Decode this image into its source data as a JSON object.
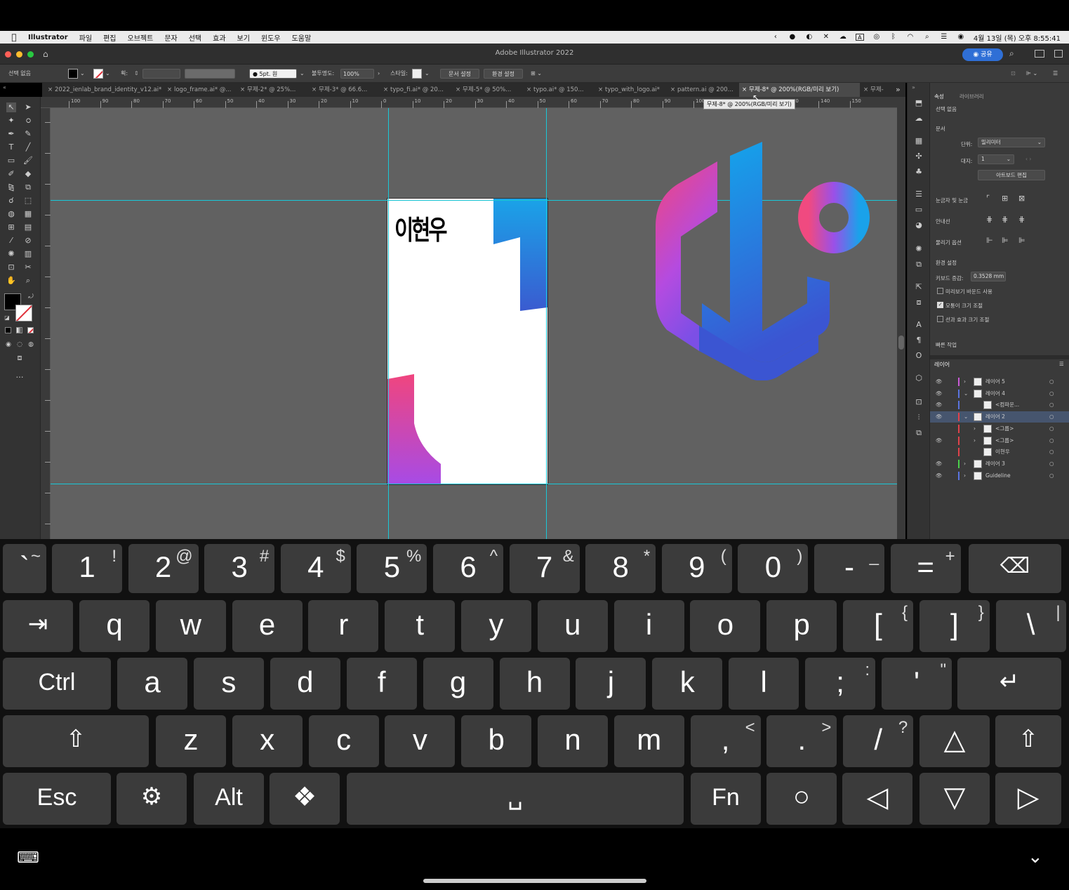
{
  "menubar": {
    "app": "Illustrator",
    "items": [
      "파일",
      "편집",
      "오브젝트",
      "문자",
      "선택",
      "효과",
      "보기",
      "윈도우",
      "도움말"
    ],
    "datetime": "4월 13일 (목) 오후 8:55:41",
    "input_indicator": "A"
  },
  "titlebar": {
    "title": "Adobe Illustrator 2022",
    "share": "공유"
  },
  "controlbar": {
    "selection": "선택 없음",
    "stroke_label": "획:",
    "brush": "5pt. 원",
    "opacity_label": "불투명도:",
    "opacity_value": "100%",
    "style_label": "스타일:",
    "doc_setup": "문서 설정",
    "prefs": "환경 설정"
  },
  "tabs": [
    {
      "label": "2022_ienlab_brand_identity_v12.ai*"
    },
    {
      "label": "logo_frame.ai* @..."
    },
    {
      "label": "무제-2* @ 25%..."
    },
    {
      "label": "무제-3* @ 66.6..."
    },
    {
      "label": "typo_fi.ai* @ 20..."
    },
    {
      "label": "무제-5* @ 50%..."
    },
    {
      "label": "typo.ai* @ 150..."
    },
    {
      "label": "typo_with_logo.ai*"
    },
    {
      "label": "pattern.ai @ 200..."
    },
    {
      "label": "무제-8* @ 200%(RGB/미리 보기)"
    },
    {
      "label": "무제-"
    }
  ],
  "tooltip": "무제-8* @ 200%(RGB/미리 보기)",
  "ruler": {
    "h_ticks": [
      "100",
      "90",
      "80",
      "70",
      "60",
      "50",
      "40",
      "30",
      "20",
      "10",
      "0",
      "10",
      "20",
      "30",
      "40",
      "50",
      "60",
      "70",
      "80",
      "90",
      "100",
      "110",
      "120",
      "130",
      "140",
      "150"
    ]
  },
  "artwork": {
    "name_text": "이현우"
  },
  "panel": {
    "tabs": [
      "속성",
      "라이브러리"
    ],
    "selection": "선택 없음",
    "doc_header": "문서",
    "unit_label": "단위:",
    "unit_value": "밀리미터",
    "artboard_label": "대지:",
    "artboard_value": "1",
    "artboard_edit": "아트보드 편집",
    "ruler_grid": "눈금자 및 눈금",
    "guides": "안내선",
    "snap": "물리기 옵션",
    "prefs_header": "환경 설정",
    "keyboard_inc_label": "키보드 증감:",
    "keyboard_inc_value": "0.3528 mm",
    "cb_preview_bounds": "미리보기 바운드 사용",
    "cb_scale_corners": "모퉁이 크기 조절",
    "cb_scale_strokes": "선과 효과 크기 조절",
    "quick_actions": "빠른 작업",
    "layers_header": "레이어"
  },
  "layers": [
    {
      "name": "레이어 5",
      "color": "#c95bd6"
    },
    {
      "name": "레이어 4",
      "color": "#5a74e0"
    },
    {
      "name": "<컴파운...",
      "color": "#5a74e0"
    },
    {
      "name": "레이어 2",
      "color": "#e0424a"
    },
    {
      "name": "<그룹>",
      "color": "#e0424a"
    },
    {
      "name": "<그룹>",
      "color": "#e0424a"
    },
    {
      "name": "이현우",
      "color": "#e0424a"
    },
    {
      "name": "레이어 3",
      "color": "#4ad04a"
    },
    {
      "name": "Guideline",
      "color": "#5a74e0"
    }
  ],
  "keyboard": {
    "row1": [
      [
        "`",
        "~"
      ],
      [
        "1",
        "!"
      ],
      [
        "2",
        "@"
      ],
      [
        "3",
        "#"
      ],
      [
        "4",
        "$"
      ],
      [
        "5",
        "%"
      ],
      [
        "6",
        "^"
      ],
      [
        "7",
        "&"
      ],
      [
        "8",
        "*"
      ],
      [
        "9",
        "("
      ],
      [
        "0",
        ")"
      ],
      [
        "-",
        "_"
      ],
      [
        "=",
        "+"
      ]
    ],
    "row2": [
      "q",
      "w",
      "e",
      "r",
      "t",
      "y",
      "u",
      "i",
      "o",
      "p",
      [
        "[",
        "{"
      ],
      [
        "]",
        "}"
      ],
      [
        "\\",
        "|"
      ]
    ],
    "row3": [
      "a",
      "s",
      "d",
      "f",
      "g",
      "h",
      "j",
      "k",
      "l",
      [
        ";",
        ":"
      ],
      [
        "'",
        "\""
      ]
    ],
    "row4": [
      "z",
      "x",
      "c",
      "v",
      "b",
      "n",
      "m",
      [
        ",",
        "<"
      ],
      [
        ".",
        ">"
      ],
      [
        "/",
        "?"
      ]
    ],
    "ctrl": "Ctrl",
    "esc": "Esc",
    "alt": "Alt",
    "fn": "Fn"
  },
  "colors": {
    "guide": "#19c8d8",
    "accent_blue": "#2f6fd6",
    "panel_bg": "#3a3a3a",
    "canvas_bg": "#616161"
  }
}
